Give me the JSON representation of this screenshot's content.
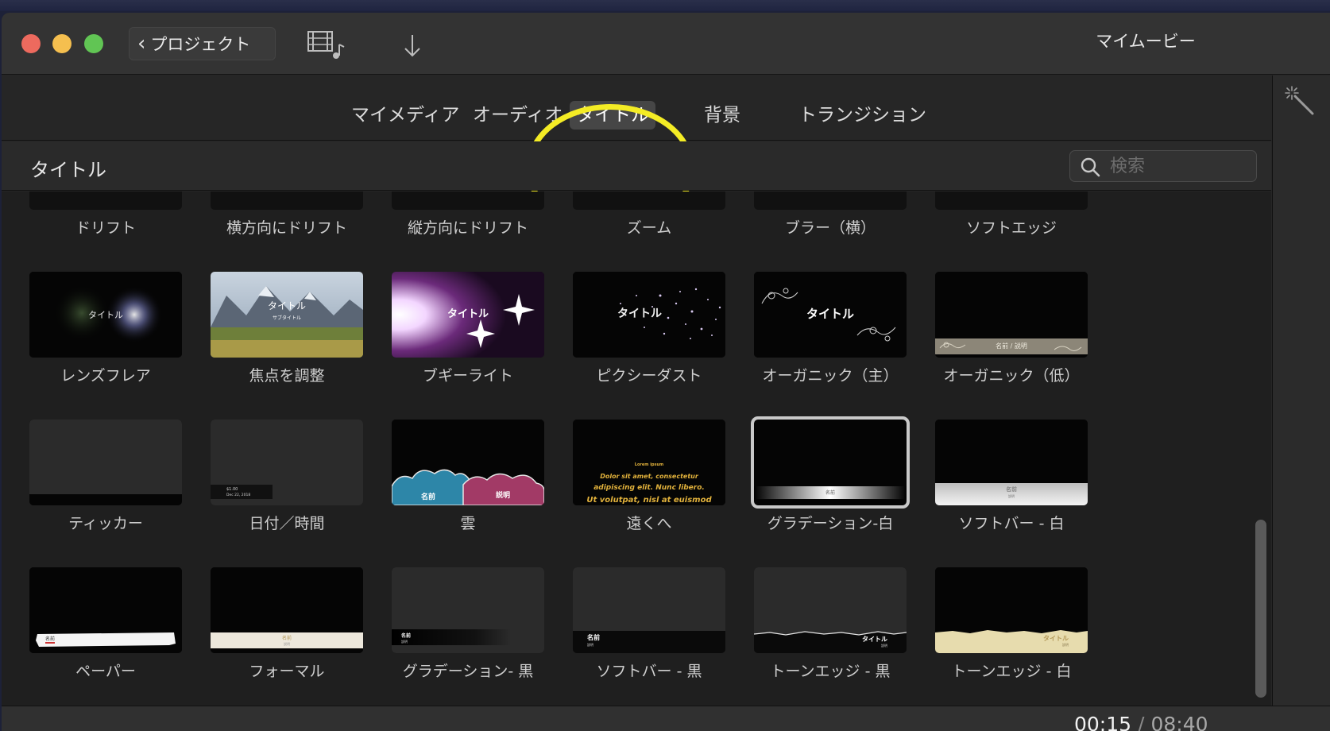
{
  "window": {
    "title": "マイムービー",
    "back_button_label": "プロジェクト"
  },
  "tabs": [
    {
      "label": "マイメディア",
      "active": false
    },
    {
      "label": "オーディオ",
      "active": false
    },
    {
      "label": "タイトル",
      "active": true
    },
    {
      "label": "背景",
      "active": false
    },
    {
      "label": "トランジション",
      "active": false
    }
  ],
  "section": {
    "title": "タイトル"
  },
  "search": {
    "placeholder": "検索",
    "value": ""
  },
  "titles": {
    "row0": [
      "ドリフト",
      "横方向にドリフト",
      "縦方向にドリフト",
      "ズーム",
      "ブラー（横）",
      "ソフトエッジ"
    ],
    "row1": [
      "レンズフレア",
      "焦点を調整",
      "ブギーライト",
      "ピクシーダスト",
      "オーガニック（主）",
      "オーガニック（低）"
    ],
    "row2": [
      "ティッカー",
      "日付／時間",
      "雲",
      "遠くへ",
      "グラデーション-白",
      "ソフトバー - 白"
    ],
    "row3": [
      "ペーパー",
      "フォーマル",
      "グラデーション- 黒",
      "ソフトバー - 黒",
      "トーンエッジ - 黒",
      "トーンエッジ - 白"
    ]
  },
  "thumb_text": {
    "title_word": "タイトル",
    "subtitle_word": "サブタイトル",
    "name_word": "名前",
    "desc_word": "説明",
    "date_line1": "$1.00",
    "date_line2": "Dec 22, 2018",
    "lorem1": "Lorem ipsum",
    "lorem2": "Dolor sit amet, consectetur",
    "lorem3": "adipiscing elit. Nunc libero.",
    "lorem4": "Ut volutpat, nisl at euismod"
  },
  "selected_title": "グラデーション-白",
  "timecode": {
    "current": "00:15",
    "separator": "/",
    "total": "08:40"
  },
  "colors": {
    "highlight_ring": "#f4ec25",
    "close": "#ed6a5e",
    "minimize": "#f5bf4f",
    "maximize": "#61c554"
  }
}
